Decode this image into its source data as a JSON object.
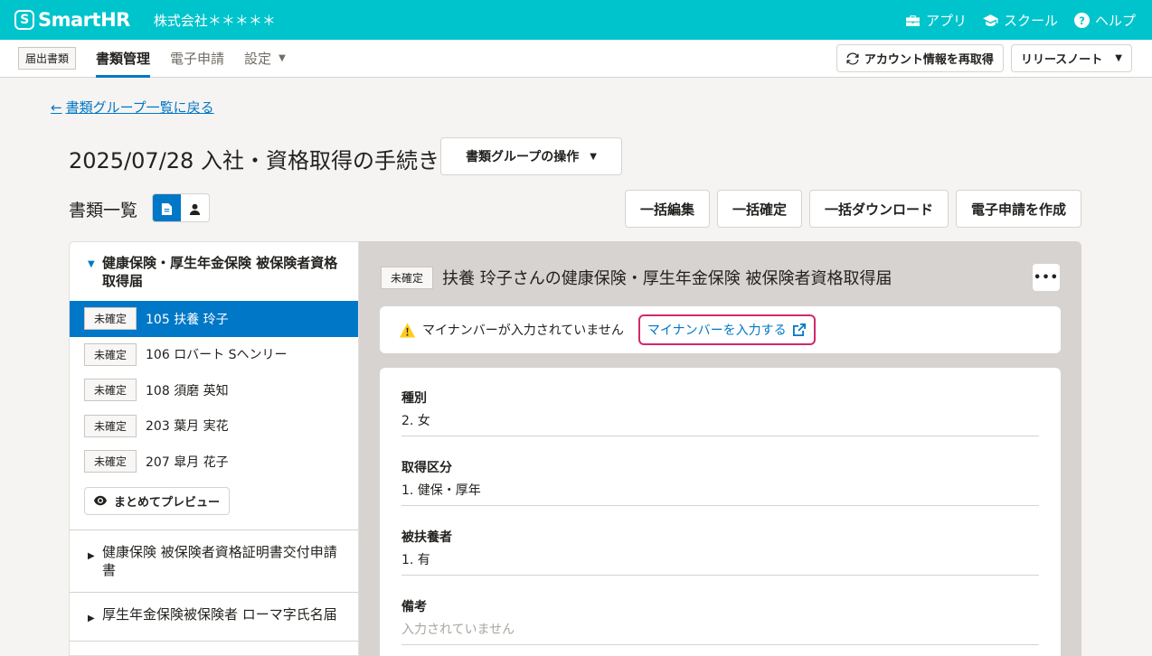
{
  "topbar": {
    "logo": "SmartHR",
    "logo_mark": "S",
    "company": "株式会社＊＊＊＊＊",
    "links": {
      "apps": "アプリ",
      "school": "スクール",
      "help": "ヘルプ"
    }
  },
  "subnav": {
    "app_label": "届出書類",
    "tabs": {
      "docs": "書類管理",
      "efiling": "電子申請",
      "settings": "設定"
    },
    "refetch": "アカウント情報を再取得",
    "release_notes": "リリースノート"
  },
  "back_link": "書類グループ一覧に戻る",
  "page_title": "2025/07/28 入社・資格取得の手続き",
  "group_ops": "書類グループの操作",
  "list_title": "書類一覧",
  "actions": {
    "bulk_edit": "一括編集",
    "bulk_confirm": "一括確定",
    "bulk_download": "一括ダウンロード",
    "create_efiling": "電子申請を作成"
  },
  "left": {
    "group1": "健康保険・厚生年金保険 被保険者資格取得届",
    "items": [
      {
        "status": "未確定",
        "label": "105 扶養 玲子"
      },
      {
        "status": "未確定",
        "label": "106 ロバート Sヘンリー"
      },
      {
        "status": "未確定",
        "label": "108 須磨 英知"
      },
      {
        "status": "未確定",
        "label": "203 葉月 実花"
      },
      {
        "status": "未確定",
        "label": "207 皐月 花子"
      }
    ],
    "preview": "まとめてプレビュー",
    "group2": "健康保険 被保険者資格証明書交付申請書",
    "group3": "厚生年金保険被保険者 ローマ字氏名届"
  },
  "right": {
    "status": "未確定",
    "title": "扶養 玲子さんの健康保険・厚生年金保険 被保険者資格取得届",
    "more": "•••",
    "alert_text": "マイナンバーが入力されていません",
    "alert_link": "マイナンバーを入力する",
    "fields": [
      {
        "label": "種別",
        "value": "2. 女"
      },
      {
        "label": "取得区分",
        "value": "1. 健保・厚年"
      },
      {
        "label": "被扶養者",
        "value": "1. 有"
      },
      {
        "label": "備考",
        "value": "入力されていません"
      }
    ]
  },
  "colors": {
    "brand": "#00c4cc",
    "primary": "#0077c7",
    "highlight": "#d2286a"
  }
}
